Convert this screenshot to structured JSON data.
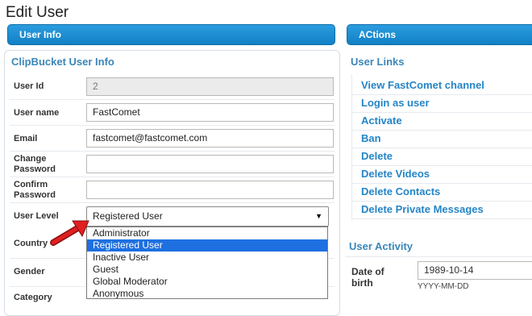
{
  "page_title": "Edit User",
  "tabs": {
    "left": "User Info",
    "right": "ACtions"
  },
  "user_info": {
    "legend": "ClipBucket User Info",
    "user_id_label": "User Id",
    "user_id_value": "2",
    "user_name_label": "User name",
    "user_name_value": "FastComet",
    "email_label": "Email",
    "email_value": "fastcomet@fastcomet.com",
    "change_password_label": "Change Password",
    "confirm_password_label": "Confirm Password",
    "user_level_label": "User Level",
    "user_level_selected": "Registered User",
    "country_label": "Country",
    "gender_label": "Gender",
    "category_label": "Category",
    "user_level_options": [
      "Administrator",
      "Registered User",
      "Inactive User",
      "Guest",
      "Global Moderator",
      "Anonymous"
    ]
  },
  "user_links": {
    "legend": "User Links",
    "items": [
      "View FastComet channel",
      "Login as user",
      "Activate",
      "Ban",
      "Delete",
      "Delete Videos",
      "Delete Contacts",
      "Delete Private Messages"
    ]
  },
  "user_activity": {
    "legend": "User Activity",
    "dob_label": "Date of birth",
    "dob_value": "1989-10-14",
    "dob_format": "YYYY-MM-DD"
  },
  "colors": {
    "accent": "#1a8cd8",
    "link": "#2485c7",
    "selected_option": "#1e70e0",
    "arrow": "#e02020"
  }
}
